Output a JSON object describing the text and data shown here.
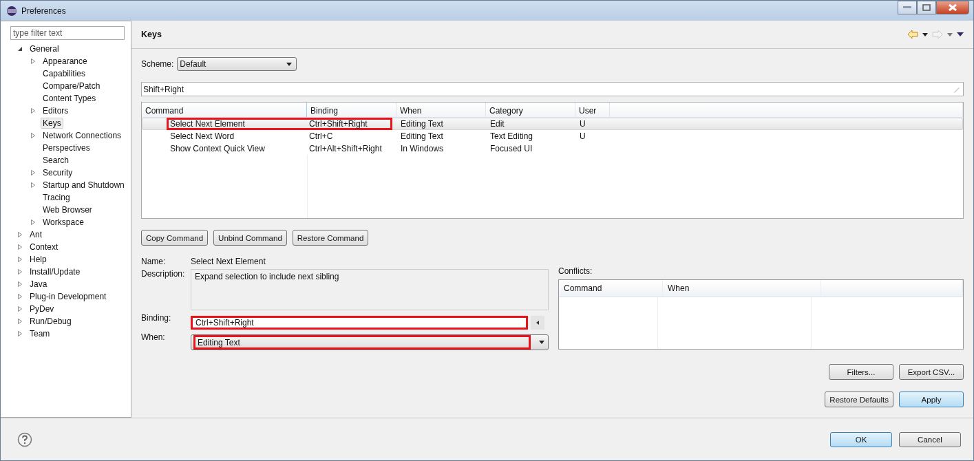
{
  "window": {
    "title": "Preferences"
  },
  "filter": {
    "placeholder": "type filter text"
  },
  "tree": [
    {
      "label": "General",
      "kind": "branch",
      "expanded": true,
      "selected": false,
      "children": [
        {
          "label": "Appearance",
          "kind": "branch",
          "expanded": false,
          "selected": false
        },
        {
          "label": "Capabilities",
          "kind": "leaf",
          "selected": false
        },
        {
          "label": "Compare/Patch",
          "kind": "leaf",
          "selected": false
        },
        {
          "label": "Content Types",
          "kind": "leaf",
          "selected": false
        },
        {
          "label": "Editors",
          "kind": "branch",
          "expanded": false,
          "selected": false
        },
        {
          "label": "Keys",
          "kind": "leaf",
          "selected": true
        },
        {
          "label": "Network Connections",
          "kind": "branch",
          "expanded": false,
          "selected": false
        },
        {
          "label": "Perspectives",
          "kind": "leaf",
          "selected": false
        },
        {
          "label": "Search",
          "kind": "leaf",
          "selected": false
        },
        {
          "label": "Security",
          "kind": "branch",
          "expanded": false,
          "selected": false
        },
        {
          "label": "Startup and Shutdown",
          "kind": "branch",
          "expanded": false,
          "selected": false
        },
        {
          "label": "Tracing",
          "kind": "leaf",
          "selected": false
        },
        {
          "label": "Web Browser",
          "kind": "leaf",
          "selected": false
        },
        {
          "label": "Workspace",
          "kind": "branch",
          "expanded": false,
          "selected": false
        }
      ]
    },
    {
      "label": "Ant",
      "kind": "branch",
      "expanded": false,
      "selected": false
    },
    {
      "label": "Context",
      "kind": "branch",
      "expanded": false,
      "selected": false
    },
    {
      "label": "Help",
      "kind": "branch",
      "expanded": false,
      "selected": false
    },
    {
      "label": "Install/Update",
      "kind": "branch",
      "expanded": false,
      "selected": false
    },
    {
      "label": "Java",
      "kind": "branch",
      "expanded": false,
      "selected": false
    },
    {
      "label": "Plug-in Development",
      "kind": "branch",
      "expanded": false,
      "selected": false
    },
    {
      "label": "PyDev",
      "kind": "branch",
      "expanded": false,
      "selected": false
    },
    {
      "label": "Run/Debug",
      "kind": "branch",
      "expanded": false,
      "selected": false
    },
    {
      "label": "Team",
      "kind": "branch",
      "expanded": false,
      "selected": false
    }
  ],
  "page": {
    "title": "Keys",
    "scheme_label": "Scheme:",
    "scheme_value": "Default",
    "search_value": "Shift+Right"
  },
  "table": {
    "columns": [
      "Command",
      "Binding",
      "When",
      "Category",
      "User"
    ],
    "rows": [
      {
        "cells": [
          "Select Next Element",
          "Ctrl+Shift+Right",
          "Editing Text",
          "Edit",
          "U"
        ],
        "selected": true,
        "highlighted": true
      },
      {
        "cells": [
          "Select Next Word",
          "Ctrl+C",
          "Editing Text",
          "Text Editing",
          "U"
        ],
        "selected": false,
        "highlighted": false
      },
      {
        "cells": [
          "Show Context Quick View",
          "Ctrl+Alt+Shift+Right",
          "In Windows",
          "Focused UI",
          ""
        ],
        "selected": false,
        "highlighted": false
      }
    ]
  },
  "command_buttons": [
    "Copy Command",
    "Unbind Command",
    "Restore Command"
  ],
  "details": {
    "name_label": "Name:",
    "name_value": "Select Next Element",
    "description_label": "Description:",
    "description_value": "Expand selection to include next sibling",
    "binding_label": "Binding:",
    "binding_value": "Ctrl+Shift+Right",
    "binding_highlighted": true,
    "when_label": "When:",
    "when_value": "Editing Text",
    "when_highlighted": true
  },
  "conflicts": {
    "label": "Conflicts:",
    "columns": [
      "Command",
      "When"
    ]
  },
  "page_buttons": [
    "Filters...",
    "Export CSV..."
  ],
  "restore_buttons": [
    {
      "label": "Restore Defaults",
      "default": false
    },
    {
      "label": "Apply",
      "default": true
    }
  ],
  "dialog_buttons": [
    {
      "label": "OK",
      "default": true
    },
    {
      "label": "Cancel",
      "default": false
    }
  ]
}
